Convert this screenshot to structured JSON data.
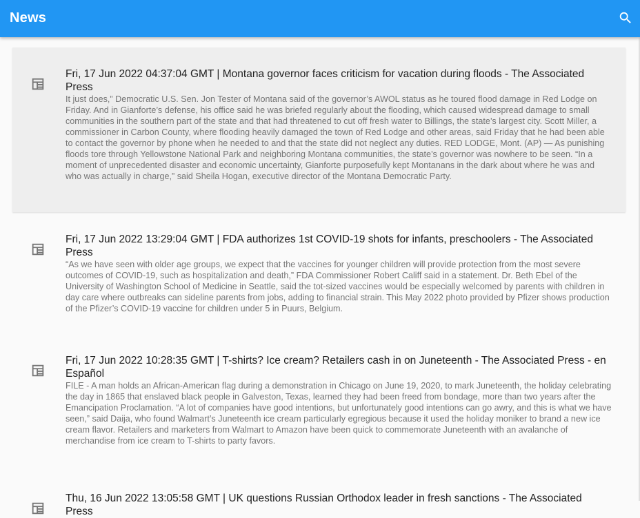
{
  "appbar": {
    "title": "News",
    "search_icon": "search-icon"
  },
  "articles": [
    {
      "selected": true,
      "icon": "article-icon",
      "headline": "Fri, 17 Jun 2022 04:37:04 GMT | Montana governor faces criticism for vacation during floods - The Associated Press",
      "summary": "It just does,” Democratic U.S. Sen. Jon Tester of Montana said of the governor’s AWOL status as he toured flood damage in Red Lodge on Friday. And in Gianforte’s defense, his office said he was briefed regularly about the flooding, which caused widespread damage to small communities in the southern part of the state and that had threatened to cut off fresh water to Billings, the state’s largest city.   Scott Miller, a commissioner in Carbon County, where flooding heavily damaged the town of Red Lodge and other areas, said Friday that he had been able to contact the governor by phone when he needed to and that the state did not neglect any duties. RED LODGE, Mont. (AP) — As punishing floods tore through Yellowstone National Park and neighboring Montana communities, the state’s governor was nowhere to be seen.   “In a moment of unprecedented disaster and economic uncertainty, Gianforte purposefully kept Montanans in the dark about where he was and who was actually in charge,” said Sheila Hogan, executive director of the Montana Democratic Party."
    },
    {
      "selected": false,
      "icon": "article-icon",
      "headline": "Fri, 17 Jun 2022 13:29:04 GMT | FDA authorizes 1st COVID-19 shots for infants, preschoolers - The Associated Press",
      "summary": "  “As we have seen with older age groups, we expect that the vaccines for younger children will provide protection from the most severe outcomes of COVID-19, such as hospitalization and death,” FDA Commissioner Robert Califf said in a statement. Dr. Beth Ebel of the University of Washington School of Medicine in Seattle, said the tot-sized vaccines would be especially welcomed by parents with children in day care where outbreaks can sideline parents from jobs, adding to financial strain. This May 2022 photo provided by Pfizer shows production of the Pfizer’s COVID-19 vaccine for children under 5 in Puurs, Belgium."
    },
    {
      "selected": false,
      "icon": "article-icon",
      "headline": "Fri, 17 Jun 2022 10:28:35 GMT | T-shirts? Ice cream? Retailers cash in on Juneteenth - The Associated Press - en Español",
      "summary": "FILE - A man holds an African-American flag during a demonstration in Chicago on June 19, 2020, to mark Juneteenth, the holiday celebrating the day in 1865 that enslaved black people in Galveston, Texas, learned they had been freed from bondage, more than two years after the Emancipation Proclamation.   “A lot of companies have good intentions, but unfortunately good intentions can go awry, and this is what we have seen,” said Daija, who found Walmart’s Juneteenth ice cream particularly egregious because it used the holiday moniker to brand a new ice cream flavor. Retailers and marketers from Walmart to Amazon have been quick to commemorate Juneteenth with an avalanche of merchandise from ice cream to T-shirts to party favors."
    },
    {
      "selected": false,
      "icon": "article-icon",
      "headline": "Thu, 16 Jun 2022 13:05:58 GMT | UK questions Russian Orthodox leader in fresh sanctions - The Associated Press",
      "summary": ""
    }
  ]
}
